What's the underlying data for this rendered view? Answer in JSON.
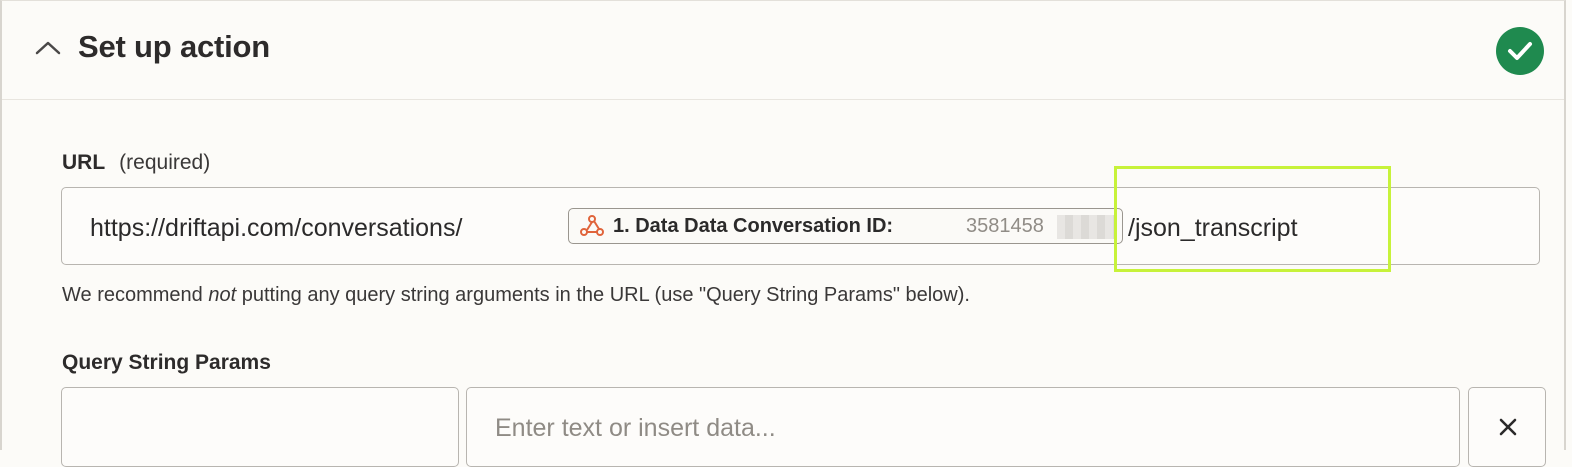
{
  "section": {
    "title": "Set up action",
    "status": "complete"
  },
  "url_field": {
    "label": "URL",
    "required_text": "(required)",
    "prefix": "https://driftapi.com/conversations/",
    "pill": {
      "icon": "webhook-icon",
      "label": "1. Data Data Conversation ID:",
      "value": "3581458"
    },
    "suffix": "/json_transcript",
    "help_before": "We recommend ",
    "help_emphasis": "not",
    "help_after": " putting any query string arguments in the URL (use \"Query String Params\" below)."
  },
  "query_params": {
    "label": "Query String Params",
    "value_placeholder": "Enter text or insert data..."
  },
  "colors": {
    "accent_highlight": "#c7f23a",
    "status_green": "#1f8a4f",
    "pill_icon": "#e0643b"
  }
}
